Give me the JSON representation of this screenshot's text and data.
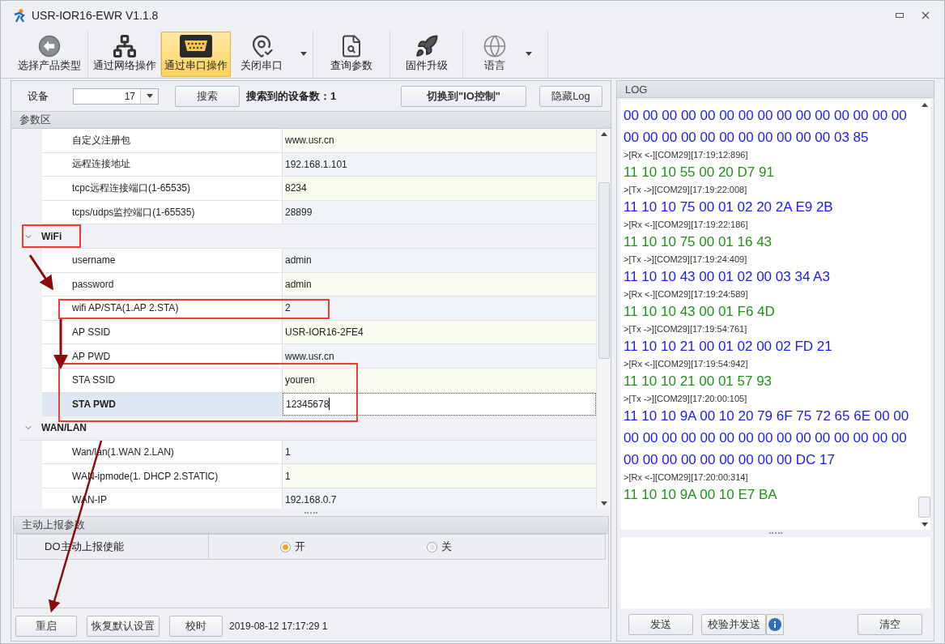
{
  "window": {
    "title": "USR-IOR16-EWR V1.1.8"
  },
  "toolbar": [
    {
      "label": "选择产品类型",
      "selected": false
    },
    {
      "label": "通过网络操作",
      "selected": false
    },
    {
      "label": "通过串口操作",
      "selected": true
    },
    {
      "label": "关闭串口",
      "selected": false,
      "dropdown": true
    },
    {
      "label": "查询参数",
      "selected": false
    },
    {
      "label": "固件升级",
      "selected": false
    },
    {
      "label": "语言",
      "selected": false,
      "dropdown": true
    }
  ],
  "device_bar": {
    "label": "设备",
    "device": "17",
    "search_button": "搜索",
    "found_label": "搜索到的设备数：1",
    "switch_button": "切换到\"IO控制\"",
    "hide_log_button": "隐藏Log"
  },
  "params": {
    "title": "参数区",
    "groups": [
      {
        "rows": [
          {
            "label": "自定义注册包",
            "value": "www.usr.cn",
            "selected": false
          },
          {
            "label": "远程连接地址",
            "value": "192.168.1.101",
            "selected": false
          },
          {
            "label": "tcpc远程连接端口(1-65535)",
            "value": "8234",
            "selected": false
          },
          {
            "label": "tcps/udps监控端口(1-65535)",
            "value": "28899",
            "selected": false
          }
        ]
      },
      {
        "title": "WiFi",
        "expanded": true,
        "rows": [
          {
            "label": "username",
            "value": "admin",
            "selected": false
          },
          {
            "label": "password",
            "value": "admin",
            "selected": false
          },
          {
            "label": "wifi AP/STA(1.AP 2.STA)",
            "value": "2",
            "selected": false
          },
          {
            "label": "AP SSID",
            "value": "USR-IOR16-2FE4",
            "selected": false
          },
          {
            "label": "AP PWD",
            "value": "www.usr.cn",
            "selected": false
          },
          {
            "label": "STA SSID",
            "value": "youren",
            "selected": false
          },
          {
            "label": "STA PWD",
            "value": "12345678",
            "selected": true
          }
        ]
      },
      {
        "title": "WAN/LAN",
        "expanded": true,
        "rows": [
          {
            "label": "Wan/lan(1.WAN 2.LAN)",
            "value": "1",
            "selected": false
          },
          {
            "label": "WAN-ipmode(1. DHCP 2.STATIC)",
            "value": "1",
            "selected": false
          },
          {
            "label": "WAN-IP",
            "value": "192.168.0.7",
            "selected": false
          }
        ]
      }
    ]
  },
  "report": {
    "title": "主动上报参数",
    "label": "DO主动上报使能",
    "options": [
      {
        "label": "开",
        "selected": true
      },
      {
        "label": "关",
        "selected": false
      }
    ]
  },
  "bottom_buttons": [
    "重启",
    "恢复默认设置",
    "校时"
  ],
  "timestamp": "2019-08-12 17:17:29 1",
  "log": {
    "title": "LOG",
    "entries": [
      {
        "kind": "tx",
        "text": "00 00 00 00 00 00 00 00 00 00 00 00 00 00 00 00 00 00 00 00 00 00 00 00 00 00 03 85"
      },
      {
        "kind": "header",
        "text": ">[Rx <-][COM29][17:19:12:896]"
      },
      {
        "kind": "rx",
        "text": "11 10 10 55 00 20 D7 91"
      },
      {
        "kind": "header",
        "text": ">[Tx ->][COM29][17:19:22:008]"
      },
      {
        "kind": "tx",
        "text": "11 10 10 75 00 01 02 20 2A E9 2B"
      },
      {
        "kind": "header",
        "text": ">[Rx <-][COM29][17:19:22:186]"
      },
      {
        "kind": "rx",
        "text": "11 10 10 75 00 01 16 43"
      },
      {
        "kind": "header",
        "text": ">[Tx ->][COM29][17:19:24:409]"
      },
      {
        "kind": "tx",
        "text": "11 10 10 43 00 01 02 00 03 34 A3"
      },
      {
        "kind": "header",
        "text": ">[Rx <-][COM29][17:19:24:589]"
      },
      {
        "kind": "rx",
        "text": "11 10 10 43 00 01 F6 4D"
      },
      {
        "kind": "header",
        "text": ">[Tx ->][COM29][17:19:54:761]"
      },
      {
        "kind": "tx",
        "text": "11 10 10 21 00 01 02 00 02 FD 21"
      },
      {
        "kind": "header",
        "text": ">[Rx <-][COM29][17:19:54:942]"
      },
      {
        "kind": "rx",
        "text": "11 10 10 21 00 01 57 93"
      },
      {
        "kind": "header",
        "text": ">[Tx ->][COM29][17:20:00:105]"
      },
      {
        "kind": "tx",
        "text": "11 10 10 9A 00 10 20 79 6F 75 72 65 6E 00 00 00 00 00 00 00 00 00 00 00 00 00 00 00 00 00 00 00 00 00 00 00 00 00 00 DC 17"
      },
      {
        "kind": "header",
        "text": ">[Rx <-][COM29][17:20:00:314]"
      },
      {
        "kind": "rx",
        "text": "11 10 10 9A 00 10 E7 BA"
      }
    ],
    "buttons": [
      "发送",
      "校验并发送",
      "清空"
    ]
  }
}
